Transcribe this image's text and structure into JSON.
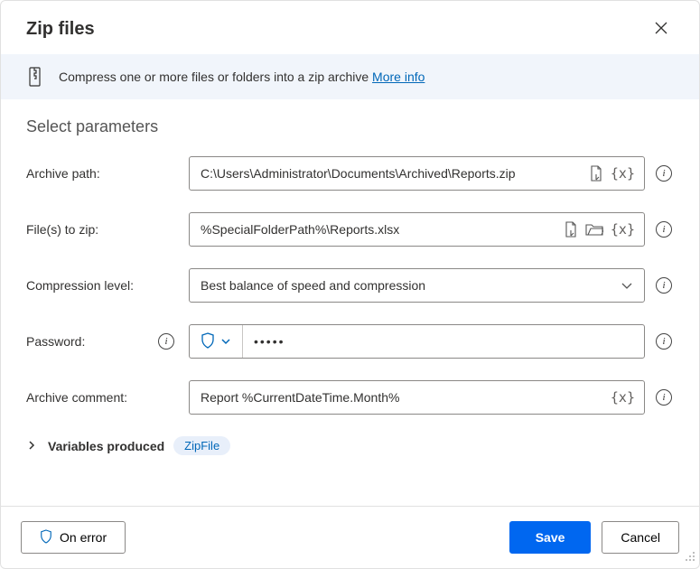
{
  "dialog": {
    "title": "Zip files",
    "banner_text": "Compress one or more files or folders into a zip archive ",
    "more_info": "More info"
  },
  "section_title": "Select parameters",
  "fields": {
    "archive_path": {
      "label": "Archive path:",
      "value": "C:\\Users\\Administrator\\Documents\\Archived\\Reports.zip"
    },
    "files_to_zip": {
      "label": "File(s) to zip:",
      "value": "%SpecialFolderPath%\\Reports.xlsx"
    },
    "compression_level": {
      "label": "Compression level:",
      "value": "Best balance of speed and compression"
    },
    "password": {
      "label": "Password:",
      "value": "•••••"
    },
    "archive_comment": {
      "label": "Archive comment:",
      "value": "Report %CurrentDateTime.Month%"
    }
  },
  "variables": {
    "label": "Variables produced",
    "chip": "ZipFile"
  },
  "footer": {
    "on_error": "On error",
    "save": "Save",
    "cancel": "Cancel"
  }
}
